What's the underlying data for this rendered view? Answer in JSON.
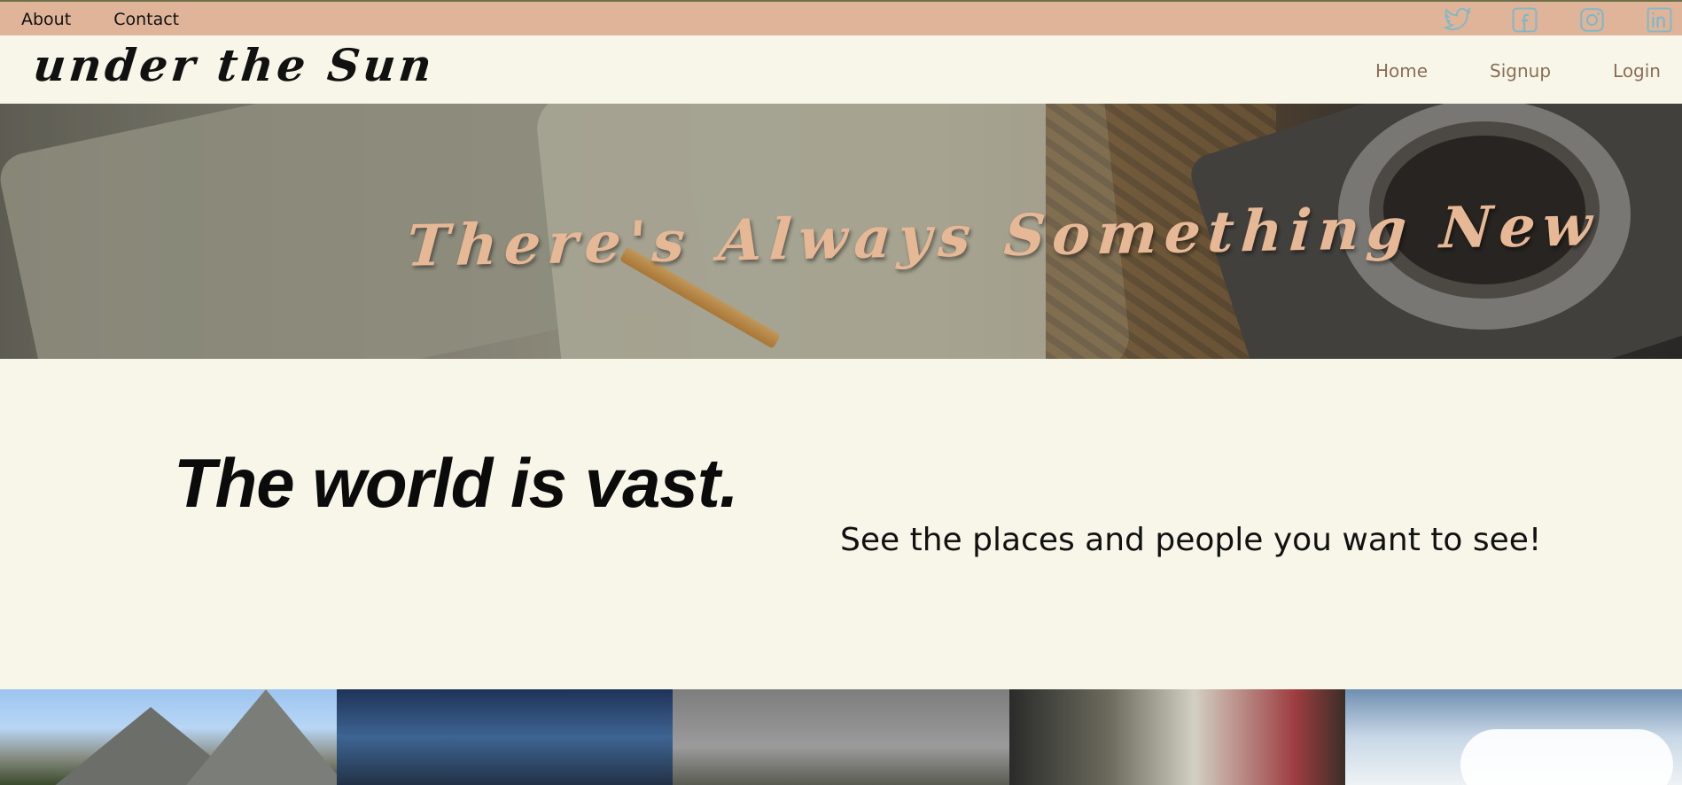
{
  "topbar": {
    "links": [
      "About",
      "Contact"
    ],
    "social": [
      "twitter-icon",
      "facebook-icon",
      "instagram-icon",
      "linkedin-icon"
    ],
    "social_color": "#7fb8c9"
  },
  "header": {
    "logo": "under the Sun",
    "nav": [
      "Home",
      "Signup",
      "Login"
    ]
  },
  "hero": {
    "headline": "There's Always Something New"
  },
  "intro": {
    "title": "The world is vast.",
    "subtitle": "See the places and people you want to see!"
  },
  "gallery": {
    "tiles": [
      "mountain-photo",
      "night-city-photo",
      "cloudy-field-photo",
      "notebook-photo",
      "sky-clouds-photo"
    ]
  },
  "colors": {
    "topbar": "#e0b498",
    "background": "#f8f6e9",
    "nav_text": "#8b6e55",
    "headline": "#e6b896"
  }
}
